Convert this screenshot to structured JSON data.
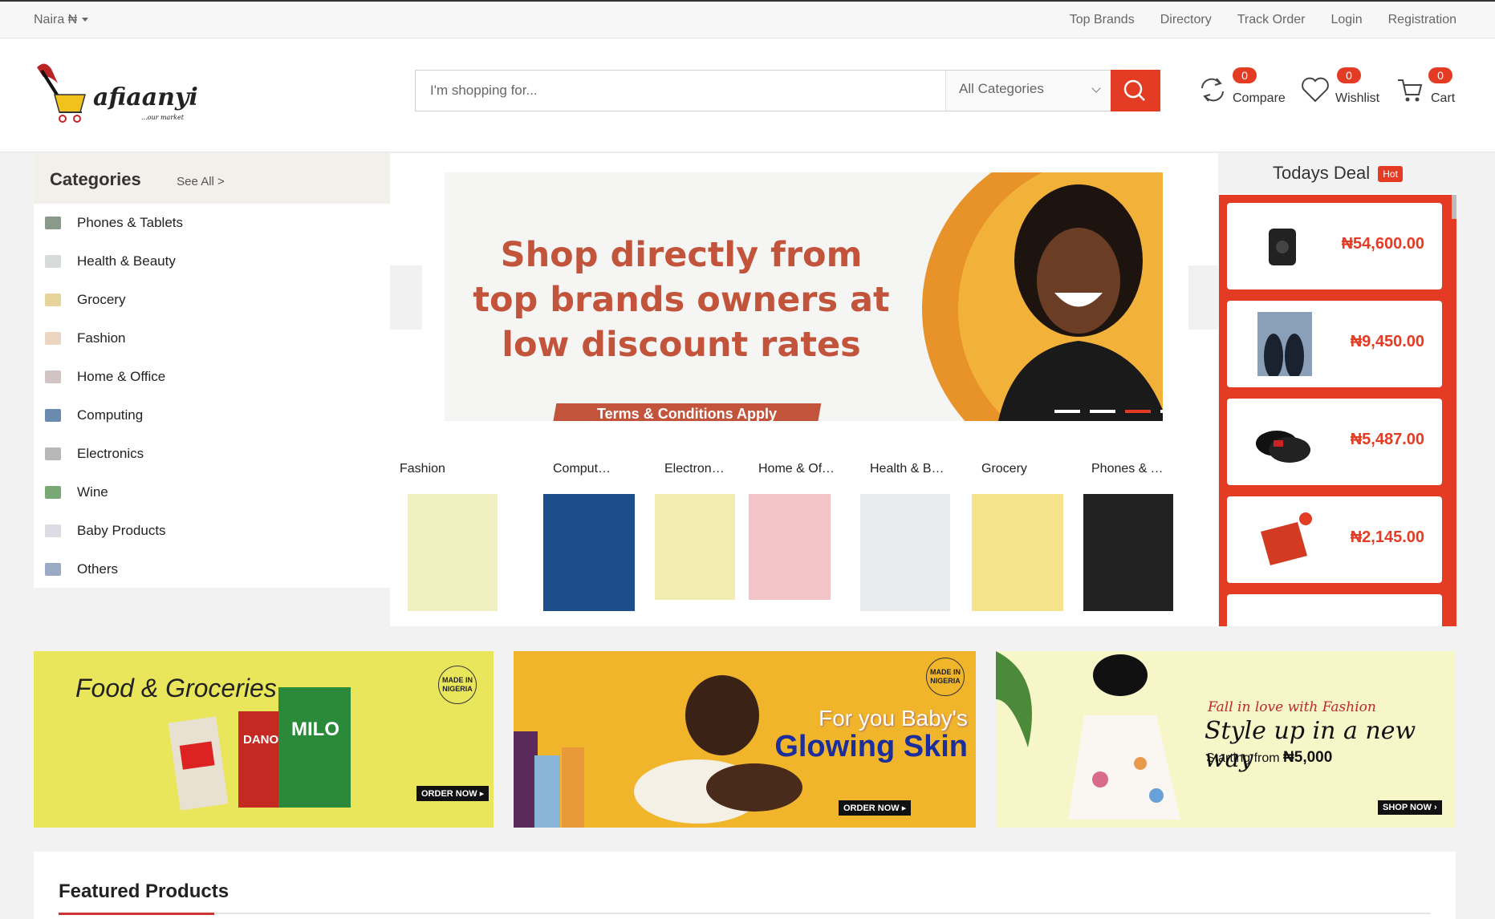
{
  "topbar": {
    "currency": "Naira ₦",
    "links": [
      "Top Brands",
      "Directory",
      "Track Order",
      "Login",
      "Registration"
    ]
  },
  "header": {
    "logo_text": "afiaanyi",
    "logo_tagline": "...our market",
    "search_placeholder": "I'm shopping for...",
    "category_select": "All Categories",
    "compare": {
      "label": "Compare",
      "count": "0"
    },
    "wishlist": {
      "label": "Wishlist",
      "count": "0"
    },
    "cart": {
      "label": "Cart",
      "count": "0"
    }
  },
  "categories": {
    "title": "Categories",
    "see_all": "See All >",
    "items": [
      "Phones & Tablets",
      "Health & Beauty",
      "Grocery",
      "Fashion",
      "Home & Office",
      "Computing",
      "Electronics",
      "Wine",
      "Baby Products",
      "Others"
    ]
  },
  "banner": {
    "line1": "Shop directly from",
    "line2": "top brands owners at",
    "line3": "low discount rates",
    "terms": "Terms & Conditions Apply",
    "active_slide": 3,
    "slide_count": 5
  },
  "subcategories": [
    "Fashion",
    "Computing",
    "Electronics",
    "Home & Offi...",
    "Health & Be...",
    "Grocery",
    "Phones & Ta..."
  ],
  "deals": {
    "title": "Todays Deal",
    "hot": "Hot",
    "items": [
      {
        "price": "₦54,600.00",
        "icon": "speaker"
      },
      {
        "price": "₦9,450.00",
        "icon": "shoes"
      },
      {
        "price": "₦5,487.00",
        "icon": "slippers"
      },
      {
        "price": "₦2,145.00",
        "icon": "spice-pack"
      }
    ]
  },
  "promos": {
    "p1": {
      "title": "Food & Groceries",
      "made_in": "MADE IN NIGERIA",
      "btn": "ORDER NOW ▸"
    },
    "p2": {
      "line1": "For you Baby's",
      "line2": "Glowing Skin",
      "made_in": "MADE IN NIGERIA",
      "btn": "ORDER NOW ▸"
    },
    "p3": {
      "line1": "Fall in love with Fashion",
      "line2": "Style up in a new way",
      "line3": "Starting from",
      "price": "₦5,000",
      "btn": "SHOP NOW ›"
    }
  },
  "featured": {
    "title": "Featured Products"
  },
  "colors": {
    "accent": "#e43c24",
    "banner_text": "#c2543c"
  }
}
